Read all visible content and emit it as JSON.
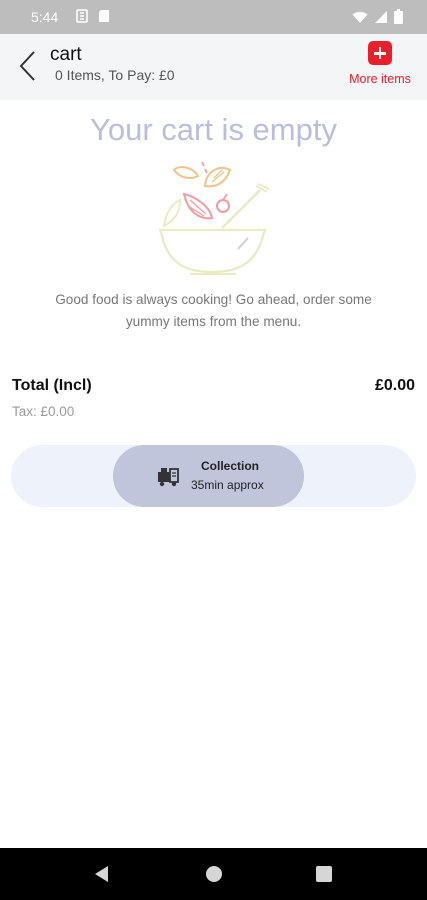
{
  "status_bar": {
    "time": "5:44"
  },
  "header": {
    "title": "cart",
    "subtitle": "0  Items, To Pay: £0",
    "more_items_label": "More items"
  },
  "empty_state": {
    "title": "Your cart is empty",
    "message_line1": "Good food is always cooking! Go ahead, order some",
    "message_line2": "yummy items from the menu."
  },
  "totals": {
    "total_label": "Total (Incl)",
    "total_value": "£0.00",
    "tax": "Tax: £0.00"
  },
  "delivery_mode": {
    "option_title": "Collection",
    "option_time": "35min approx",
    "icon": "collection-icon"
  },
  "colors": {
    "accent": "#e8202a",
    "empty_title": "#b9bedd",
    "pill_bg": "#c0c5dc",
    "pill_track": "#eef3fb"
  }
}
